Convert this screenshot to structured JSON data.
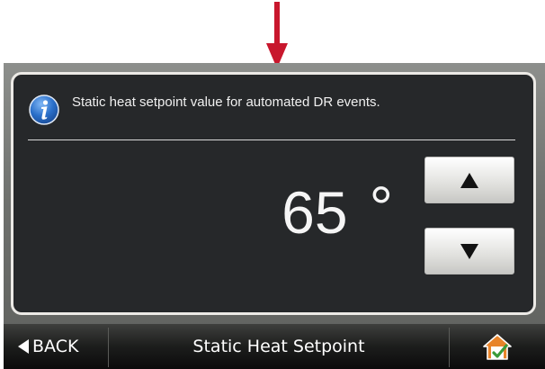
{
  "info": {
    "icon": "info-icon",
    "text": "Static heat setpoint value for automated DR events."
  },
  "setpoint": {
    "value": "65",
    "unit": "°",
    "up_icon": "triangle-up-icon",
    "down_icon": "triangle-down-icon"
  },
  "nav": {
    "back_label": "BACK",
    "title": "Static Heat Setpoint",
    "home_icon": "home-icon"
  },
  "colors": {
    "pointer_arrow": "#c8172d",
    "panel_bg": "#26282a",
    "info_blue": "#2a6fc9",
    "home_orange": "#e8842a",
    "home_check": "#3a9a3a"
  }
}
